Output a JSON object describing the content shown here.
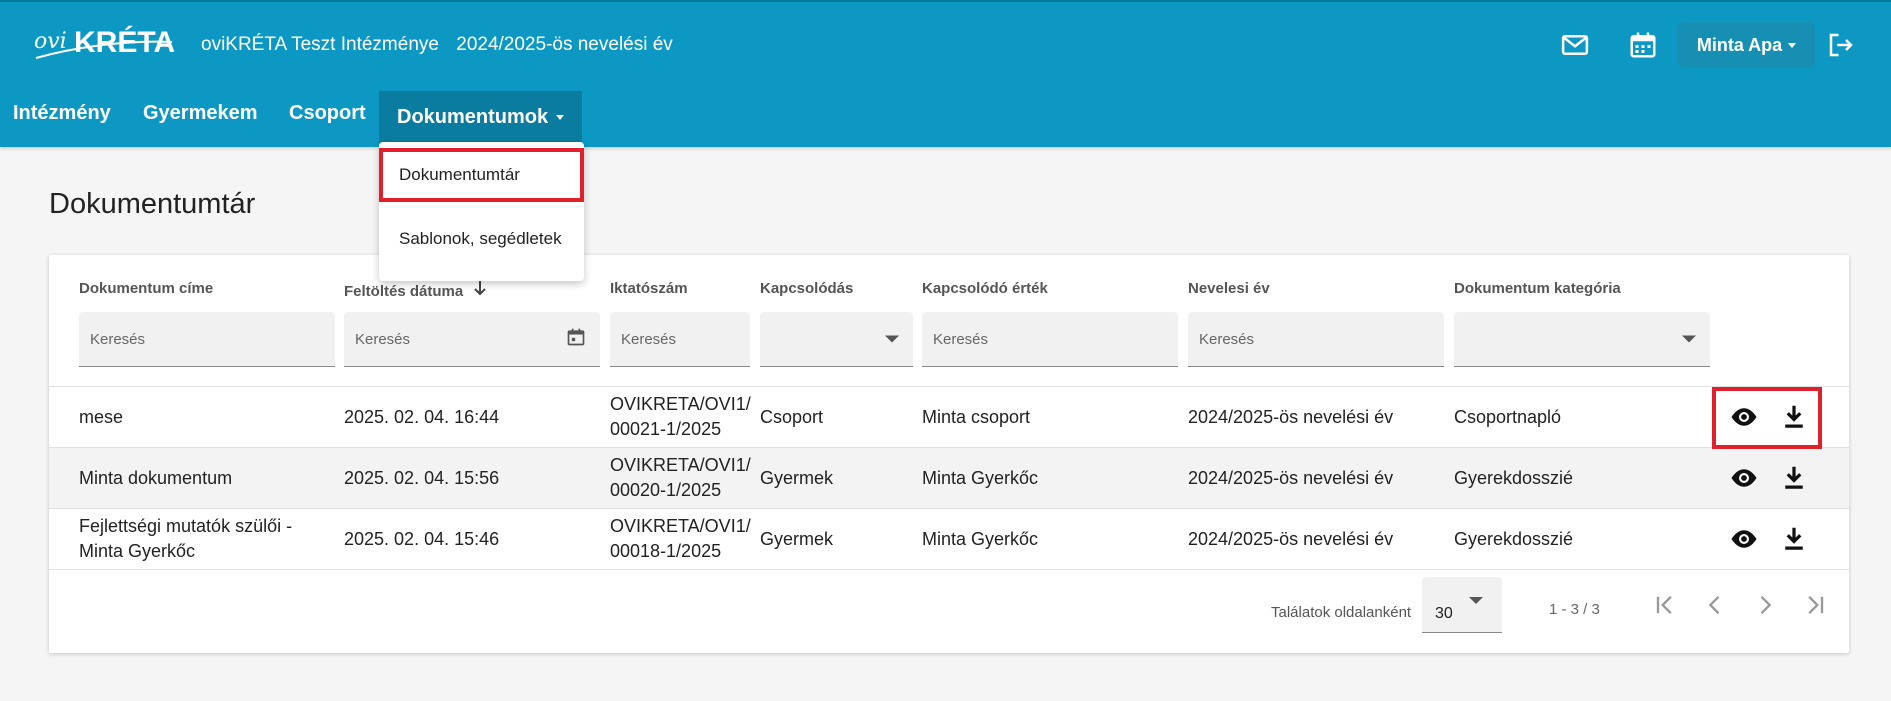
{
  "header": {
    "logo_text": "oviKRÉTA",
    "school_name": "oviKRÉTA Teszt Intézménye",
    "school_year": "2024/2025-ös nevelési év",
    "user_name": "Minta Apa",
    "icons": [
      "mail-icon",
      "calendar-icon",
      "logout-icon"
    ]
  },
  "nav": {
    "items": [
      {
        "label": "Intézmény"
      },
      {
        "label": "Gyermekem"
      },
      {
        "label": "Csoport"
      },
      {
        "label": "Dokumentumok"
      }
    ],
    "dropdown": [
      {
        "label": "Dokumentumtár"
      },
      {
        "label": "Sablonok, segédletek"
      }
    ]
  },
  "page": {
    "title": "Dokumentumtár"
  },
  "table": {
    "columns": [
      {
        "label": "Dokumentum címe",
        "placeholder": "Keresés"
      },
      {
        "label": "Feltöltés dátuma",
        "placeholder": "Keresés"
      },
      {
        "label": "Iktatószám",
        "placeholder": "Keresés"
      },
      {
        "label": "Kapcsolódás",
        "placeholder": ""
      },
      {
        "label": "Kapcsolódó érték",
        "placeholder": "Keresés"
      },
      {
        "label": "Nevelesi év",
        "placeholder": "Keresés"
      },
      {
        "label": "Dokumentum kategória",
        "placeholder": ""
      }
    ],
    "rows": [
      {
        "title": "mese",
        "date": "2025. 02. 04. 16:44",
        "number_1": "OVIKRETA/OVI1/",
        "number_2": "00021-1/2025",
        "link": "Csoport",
        "link_value": "Minta csoport",
        "year": "2024/2025-ös nevelési év",
        "category": "Csoportnapló"
      },
      {
        "title": "Minta dokumentum",
        "date": "2025. 02. 04. 15:56",
        "number_1": "OVIKRETA/OVI1/",
        "number_2": "00020-1/2025",
        "link": "Gyermek",
        "link_value": "Minta Gyerkőc",
        "year": "2024/2025-ös nevelési év",
        "category": "Gyerekdosszié"
      },
      {
        "title_1": "Fejlettségi mutatók szülői -",
        "title_2": "Minta Gyerkőc",
        "date": "2025. 02. 04. 15:46",
        "number_1": "OVIKRETA/OVI1/",
        "number_2": "00018-1/2025",
        "link": "Gyermek",
        "link_value": "Minta Gyerkőc",
        "year": "2024/2025-ös nevelési év",
        "category": "Gyerekdosszié"
      }
    ]
  },
  "pagination": {
    "per_page_label": "Találatok oldalanként",
    "per_page_value": "30",
    "range": "1 - 3 / 3"
  },
  "colors": {
    "header_bg": "#0c98c2",
    "nav_active_bg": "#0a7c9f",
    "highlight": "#e0202a"
  }
}
